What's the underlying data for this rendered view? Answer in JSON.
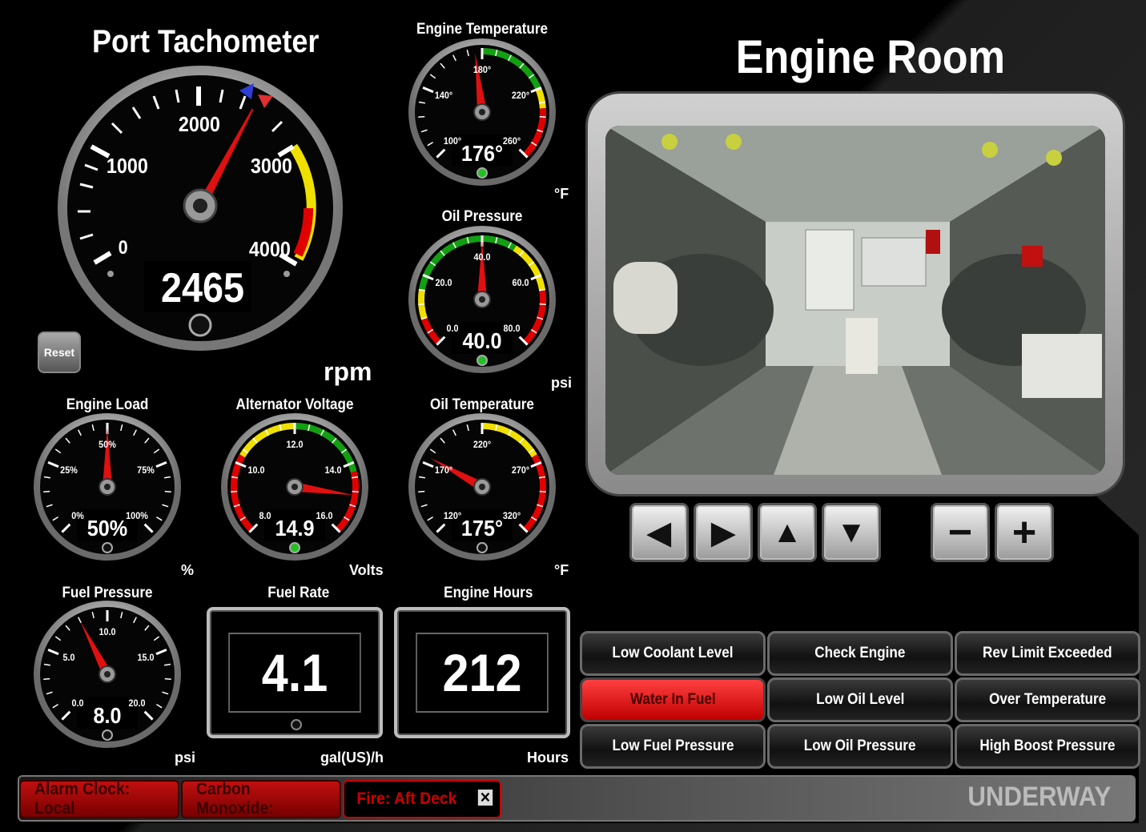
{
  "tachometer": {
    "title": "Port Tachometer",
    "value": "2465",
    "unit": "rpm",
    "ticks": [
      "0",
      "1000",
      "2000",
      "3000",
      "4000"
    ],
    "reset_label": "Reset",
    "reading": 2465
  },
  "engine_temp": {
    "title": "Engine Temperature",
    "value": "176°",
    "unit": "°F",
    "ticks": [
      "100°",
      "140°",
      "180°",
      "220°",
      "260°"
    ],
    "reading": 176
  },
  "oil_pressure": {
    "title": "Oil Pressure",
    "value": "40.0",
    "unit": "psi",
    "ticks": [
      "0.0",
      "20.0",
      "40.0",
      "60.0",
      "80.0"
    ],
    "reading": 40
  },
  "engine_load": {
    "title": "Engine Load",
    "value": "50%",
    "unit": "%",
    "ticks": [
      "0%",
      "25%",
      "50%",
      "75%",
      "100%"
    ],
    "reading": 50
  },
  "alternator": {
    "title": "Alternator Voltage",
    "value": "14.9",
    "unit": "Volts",
    "ticks": [
      "8.0",
      "10.0",
      "12.0",
      "14.0",
      "16.0"
    ],
    "reading": 14.9
  },
  "oil_temp": {
    "title": "Oil Temperature",
    "value": "175°",
    "unit": "°F",
    "ticks": [
      "120°",
      "170°",
      "220°",
      "270°",
      "320°"
    ],
    "reading": 175
  },
  "fuel_pressure": {
    "title": "Fuel Pressure",
    "value": "8.0",
    "unit": "psi",
    "ticks": [
      "0.0",
      "5.0",
      "10.0",
      "15.0",
      "20.0"
    ],
    "reading": 8
  },
  "fuel_rate": {
    "title": "Fuel Rate",
    "value": "4.1",
    "unit": "gal(US)/h"
  },
  "engine_hours": {
    "title": "Engine Hours",
    "value": "212",
    "unit": "Hours"
  },
  "camera": {
    "title": "Engine Room",
    "controls": [
      "left",
      "right",
      "up",
      "down",
      "zoom-out",
      "zoom-in"
    ]
  },
  "alarms": [
    {
      "label": "Low Coolant Level",
      "active": false
    },
    {
      "label": "Check Engine",
      "active": false
    },
    {
      "label": "Rev Limit Exceeded",
      "active": false
    },
    {
      "label": "Water In Fuel",
      "active": true
    },
    {
      "label": "Low Oil Level",
      "active": false
    },
    {
      "label": "Over Temperature",
      "active": false
    },
    {
      "label": "Low Fuel Pressure",
      "active": false
    },
    {
      "label": "Low Oil Pressure",
      "active": false
    },
    {
      "label": "High Boost Pressure",
      "active": false
    }
  ],
  "status_bar": {
    "tags": [
      "Alarm Clock: Local",
      "Carbon Monoxide:",
      "Fire: Aft Deck"
    ],
    "mode": "UNDERWAY"
  },
  "colors": {
    "red": "#e00000",
    "yellow": "#f0e000",
    "green": "#12a012",
    "accent": "#ff2a2a"
  }
}
